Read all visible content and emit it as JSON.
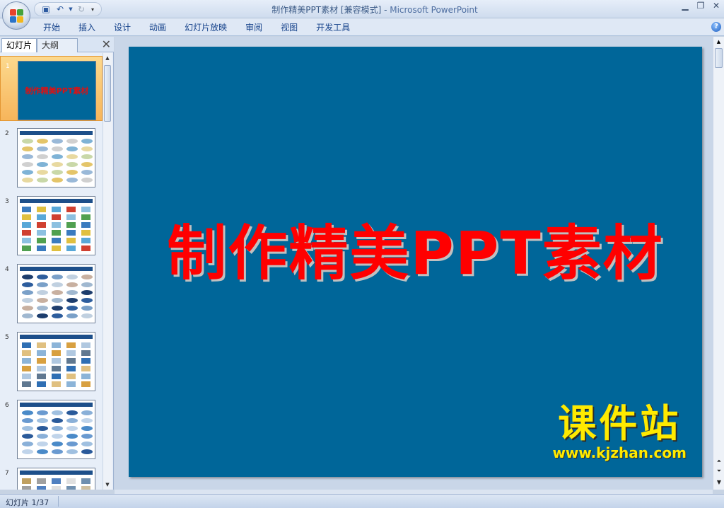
{
  "window": {
    "title": "制作精美PPT素材 [兼容模式]",
    "separator": " - ",
    "app_name": "Microsoft PowerPoint"
  },
  "ribbon": {
    "tabs": [
      "开始",
      "插入",
      "设计",
      "动画",
      "幻灯片放映",
      "审阅",
      "视图",
      "开发工具"
    ]
  },
  "pane": {
    "tab_slides": "幻灯片",
    "tab_outline": "大纲",
    "close": "✕"
  },
  "slides": [
    {
      "number": "1",
      "selected": true,
      "mini_title": "制作精美PPT素材"
    },
    {
      "number": "2"
    },
    {
      "number": "3"
    },
    {
      "number": "4"
    },
    {
      "number": "5"
    },
    {
      "number": "6"
    },
    {
      "number": "7"
    }
  ],
  "slide": {
    "title": "制作精美PPT素材",
    "background": "#006699",
    "title_color": "#ff0000"
  },
  "watermark": {
    "line1": "课件站",
    "line2": "www.kjzhan.com"
  },
  "statusbar": {
    "slide_info": "幻灯片 1/37"
  },
  "icons": [
    "office-button-icon",
    "save-icon",
    "undo-icon",
    "redo-icon",
    "customize-qat-icon",
    "minimize-icon",
    "restore-icon",
    "close-icon",
    "help-icon"
  ]
}
